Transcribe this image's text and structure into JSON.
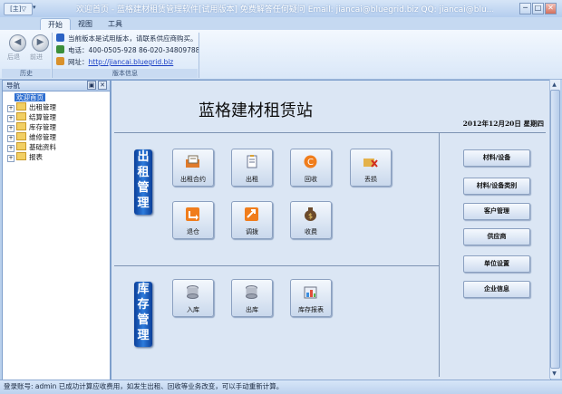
{
  "window": {
    "title": "欢迎首页 - 蓝格建材租赁管理软件[试用版本] 免费解答任何疑问 Email: jiancai@bluegrid.biz  QQ: jiancai@blu...",
    "qat_label": "[主]▽",
    "min": "─",
    "max": "□",
    "close": "✕"
  },
  "tabs": [
    "开始",
    "视图",
    "工具"
  ],
  "ribbon": {
    "nav": {
      "back": "后退",
      "forward": "前进",
      "group": "历史"
    },
    "version": {
      "notice": "当前版本是试用版本，请联系供应商购买。",
      "phone_label": "电话：",
      "phone": "400-0505-928  86-020-34809788",
      "url_label": "网址：",
      "url": "http://jiancai.bluegrid.biz",
      "group": "版本信息"
    }
  },
  "nav_pane": {
    "title": "导航",
    "pin": "▣",
    "close": "✕",
    "items": [
      "欢迎首页",
      "出租管理",
      "结算管理",
      "库存管理",
      "维修管理",
      "基础资料",
      "报表"
    ]
  },
  "main": {
    "title": "蓝格建材租赁站",
    "date": "2012年12月20日 星期四",
    "rent_banner": "出租管理",
    "stock_banner": "库存管理",
    "rent_tiles": [
      "出租合约",
      "出租",
      "回收",
      "丢损",
      "退仓",
      "调拨",
      "收费"
    ],
    "stock_tiles": [
      "入库",
      "出库",
      "库存报表"
    ],
    "right_buttons": [
      "材料/设备",
      "材料/设备类别",
      "客户管理",
      "供应商",
      "单位设置",
      "企业信息"
    ]
  },
  "statusbar": {
    "text": "登录账号: admin  已成功计算应收费用，如发生出租、回收等业务改变，可以手动重新计算。"
  },
  "colors": {
    "ribbon_bg": "#dbe8f8",
    "banner_blue": "#1756b8",
    "selection": "#2f6fd0",
    "link": "#1a3fc4"
  }
}
